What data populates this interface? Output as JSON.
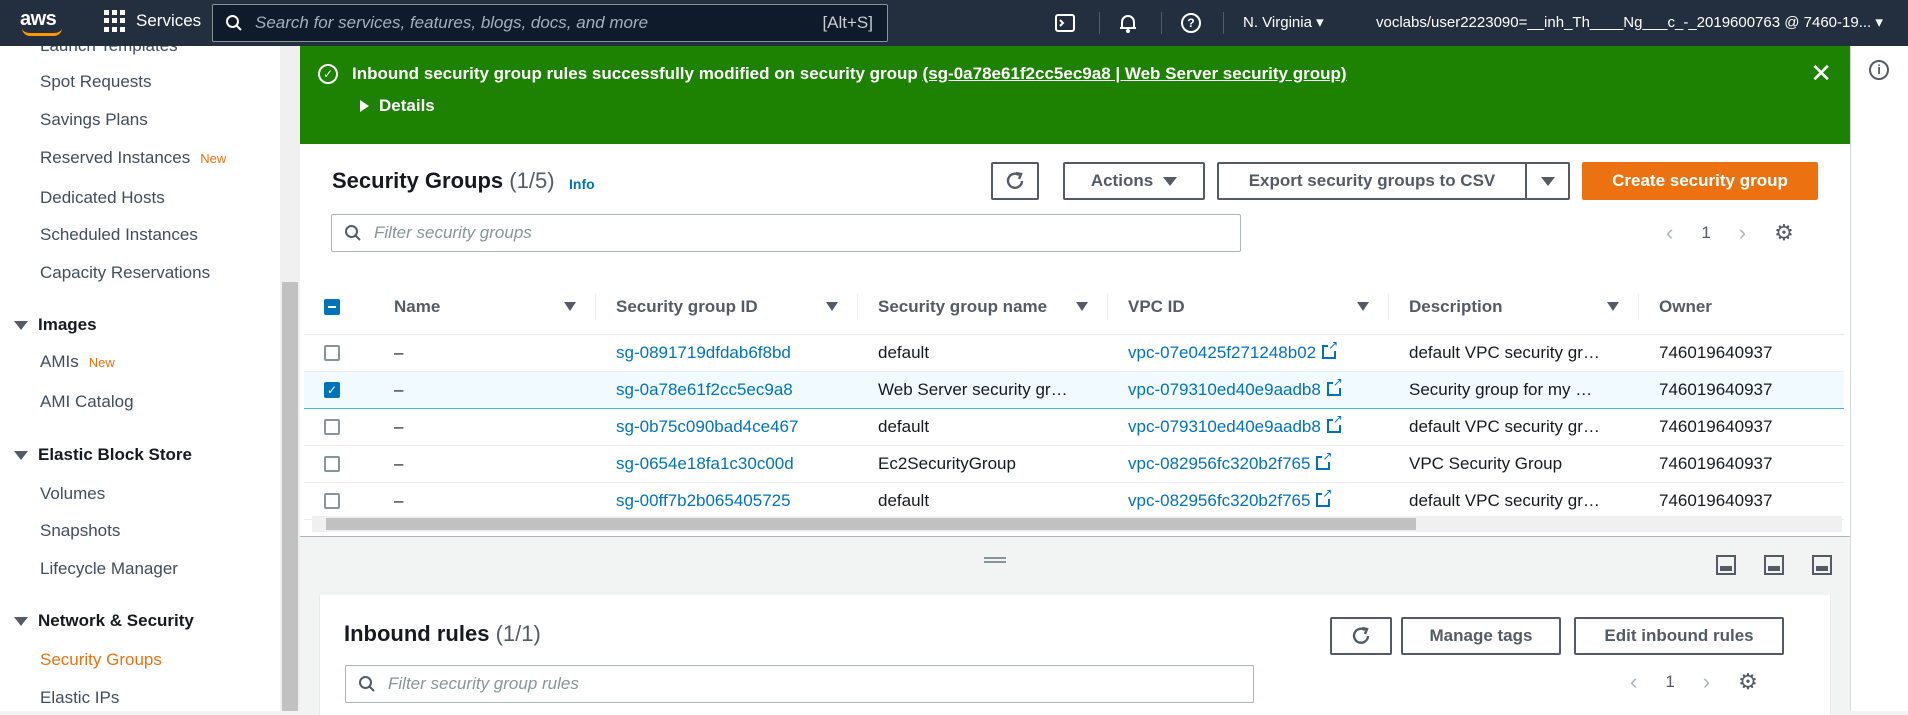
{
  "topnav": {
    "logo_text": "aws",
    "services_label": "Services",
    "search_placeholder": "Search for services, features, blogs, docs, and more",
    "search_shortcut": "[Alt+S]",
    "region": "N. Virginia",
    "account": "voclabs/user2223090=__inh_Th____Ng___c_-_2019600763 @ 7460-19..."
  },
  "sidebar": {
    "items": [
      {
        "label": "Launch Templates"
      },
      {
        "label": "Spot Requests"
      },
      {
        "label": "Savings Plans"
      },
      {
        "label": "Reserved Instances",
        "badge": "New"
      },
      {
        "label": "Dedicated Hosts"
      },
      {
        "label": "Scheduled Instances"
      },
      {
        "label": "Capacity Reservations"
      }
    ],
    "images_section": "Images",
    "images_items": [
      {
        "label": "AMIs",
        "badge": "New"
      },
      {
        "label": "AMI Catalog"
      }
    ],
    "ebs_section": "Elastic Block Store",
    "ebs_items": [
      {
        "label": "Volumes"
      },
      {
        "label": "Snapshots"
      },
      {
        "label": "Lifecycle Manager"
      }
    ],
    "network_section": "Network & Security",
    "network_items": [
      {
        "label": "Security Groups"
      },
      {
        "label": "Elastic IPs"
      }
    ]
  },
  "flash": {
    "message": "Inbound security group rules successfully modified on security group ",
    "link": "(sg-0a78e61f2cc5ec9a8 | Web Server security group)",
    "details_label": "Details"
  },
  "main": {
    "title": "Security Groups",
    "count": "(1/5)",
    "info_label": "Info",
    "actions_label": "Actions",
    "export_label": "Export security groups to CSV",
    "create_label": "Create security group",
    "filter_placeholder": "Filter security groups",
    "page_number": "1",
    "columns": [
      "Name",
      "Security group ID",
      "Security group name",
      "VPC ID",
      "Description",
      "Owner"
    ],
    "rows": [
      {
        "name": "–",
        "sg_id": "sg-0891719dfdab6f8bd",
        "sg_name": "default",
        "vpc": "vpc-07e0425f271248b02",
        "desc": "default VPC security gr…",
        "owner": "746019640937"
      },
      {
        "name": "–",
        "sg_id": "sg-0a78e61f2cc5ec9a8",
        "sg_name": "Web Server security gr…",
        "vpc": "vpc-079310ed40e9aadb8",
        "desc": "Security group for my …",
        "owner": "746019640937"
      },
      {
        "name": "–",
        "sg_id": "sg-0b75c090bad4ce467",
        "sg_name": "default",
        "vpc": "vpc-079310ed40e9aadb8",
        "desc": "default VPC security gr…",
        "owner": "746019640937"
      },
      {
        "name": "–",
        "sg_id": "sg-0654e18fa1c30c00d",
        "sg_name": "Ec2SecurityGroup",
        "vpc": "vpc-082956fc320b2f765",
        "desc": "VPC Security Group",
        "owner": "746019640937"
      },
      {
        "name": "–",
        "sg_id": "sg-00ff7b2b065405725",
        "sg_name": "default",
        "vpc": "vpc-082956fc320b2f765",
        "desc": "default VPC security gr…",
        "owner": "746019640937"
      }
    ]
  },
  "inbound": {
    "title": "Inbound rules",
    "count": "(1/1)",
    "manage_tags_label": "Manage tags",
    "edit_label": "Edit inbound rules",
    "filter_placeholder": "Filter security group rules",
    "page_number": "1"
  },
  "colors": {
    "nav_bg": "#232f3e",
    "success": "#1d8102",
    "primary_button": "#ec7211",
    "link": "#0073bb"
  }
}
